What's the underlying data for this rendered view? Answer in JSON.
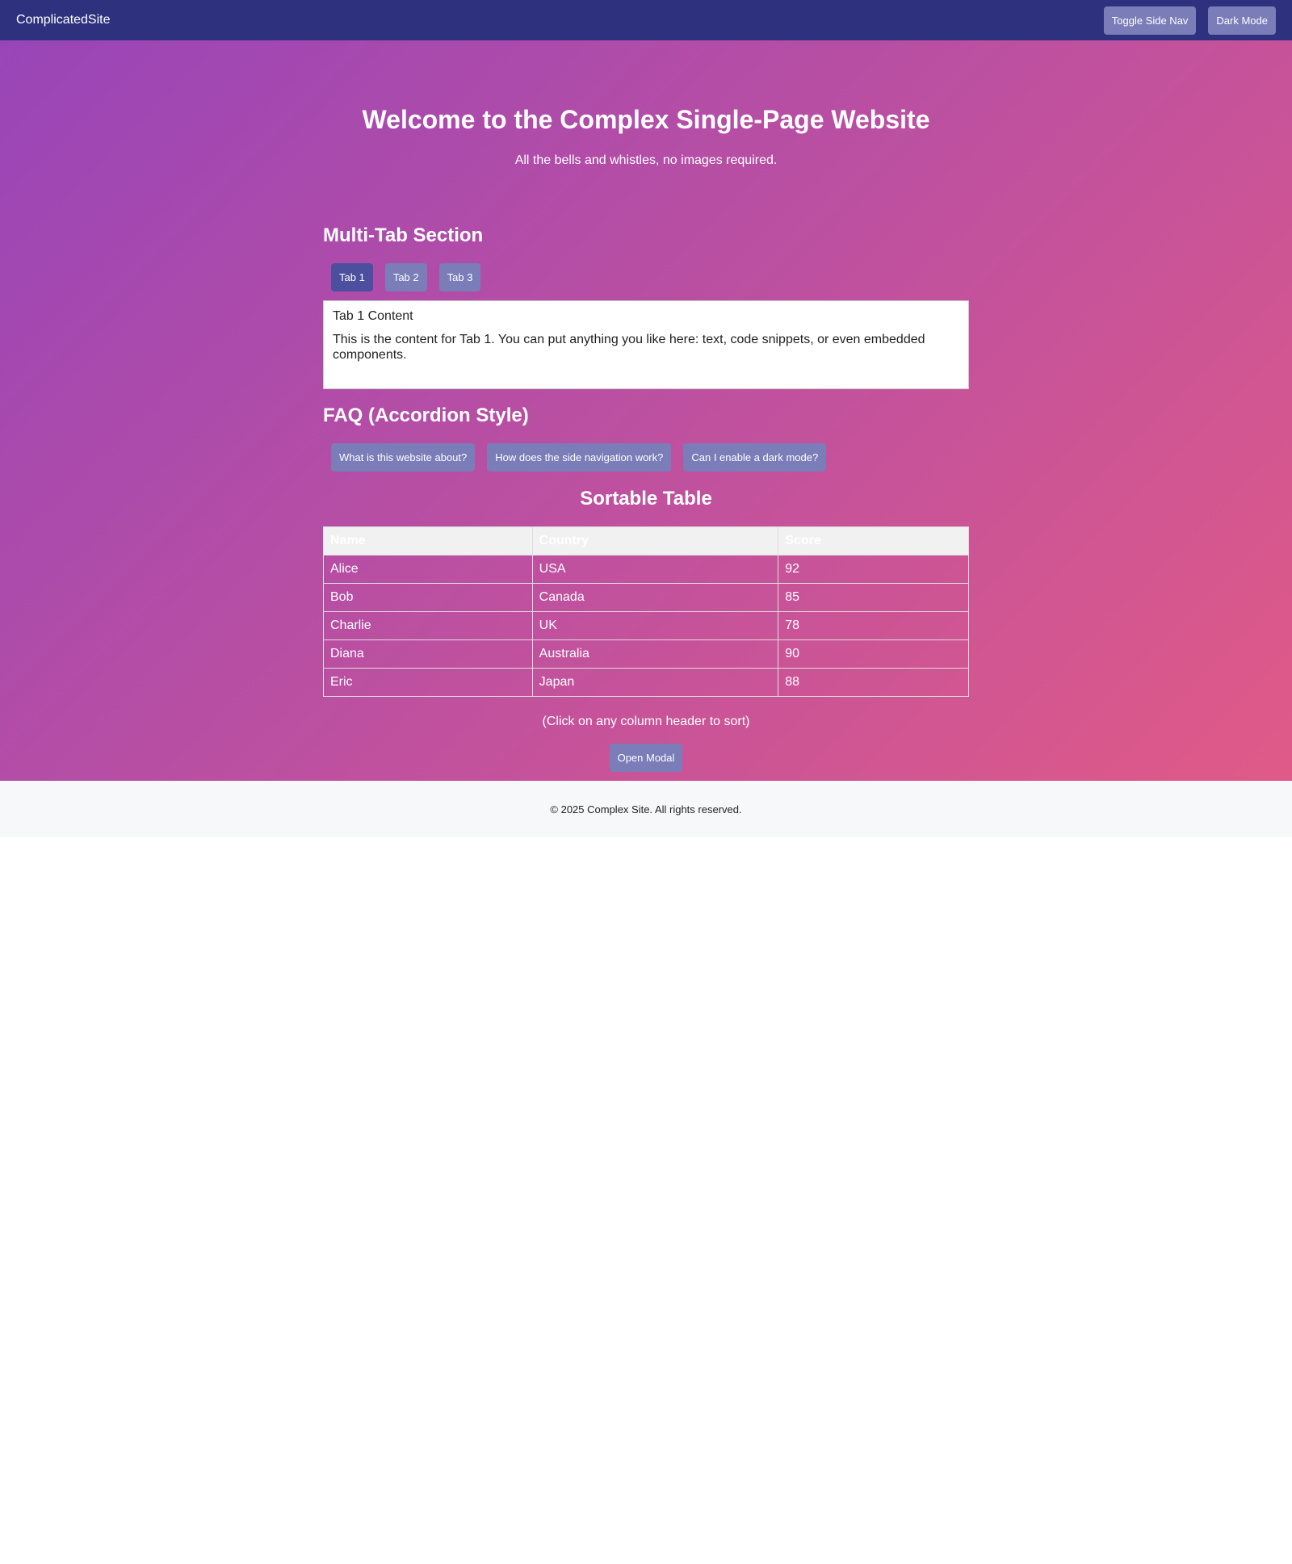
{
  "navbar": {
    "brand": "ComplicatedSite",
    "toggle_side_nav_label": "Toggle Side Nav",
    "dark_mode_label": "Dark Mode"
  },
  "hero": {
    "title": "Welcome to the Complex Single-Page Website",
    "subtitle": "All the bells and whistles, no images required."
  },
  "tabs_section": {
    "title": "Multi-Tab Section",
    "tabs": [
      {
        "label": "Tab 1",
        "active": true
      },
      {
        "label": "Tab 2",
        "active": false
      },
      {
        "label": "Tab 3",
        "active": false
      }
    ],
    "panel": {
      "title": "Tab 1 Content",
      "text": "This is the content for Tab 1. You can put anything you like here: text, code snippets, or even embedded components."
    }
  },
  "faq": {
    "title": "FAQ (Accordion Style)",
    "items": [
      {
        "label": "What is this website about?"
      },
      {
        "label": "How does the side navigation work?"
      },
      {
        "label": "Can I enable a dark mode?"
      }
    ]
  },
  "table": {
    "title": "Sortable Table",
    "headers": [
      "Name",
      "Country",
      "Score"
    ],
    "rows": [
      [
        "Alice",
        "USA",
        "92"
      ],
      [
        "Bob",
        "Canada",
        "85"
      ],
      [
        "Charlie",
        "UK",
        "78"
      ],
      [
        "Diana",
        "Australia",
        "90"
      ],
      [
        "Eric",
        "Japan",
        "88"
      ]
    ],
    "hint": "(Click on any column header to sort)"
  },
  "modal": {
    "open_label": "Open Modal"
  },
  "footer": {
    "text": "© 2025 Complex Site. All rights reserved."
  },
  "colors": {
    "navbar": "#2e327e",
    "button": "#7a7db8",
    "button_active": "#4c4f9e",
    "gradient_start": "#9945b8",
    "gradient_end": "#e05a87",
    "footer": "#f7f8f9"
  }
}
